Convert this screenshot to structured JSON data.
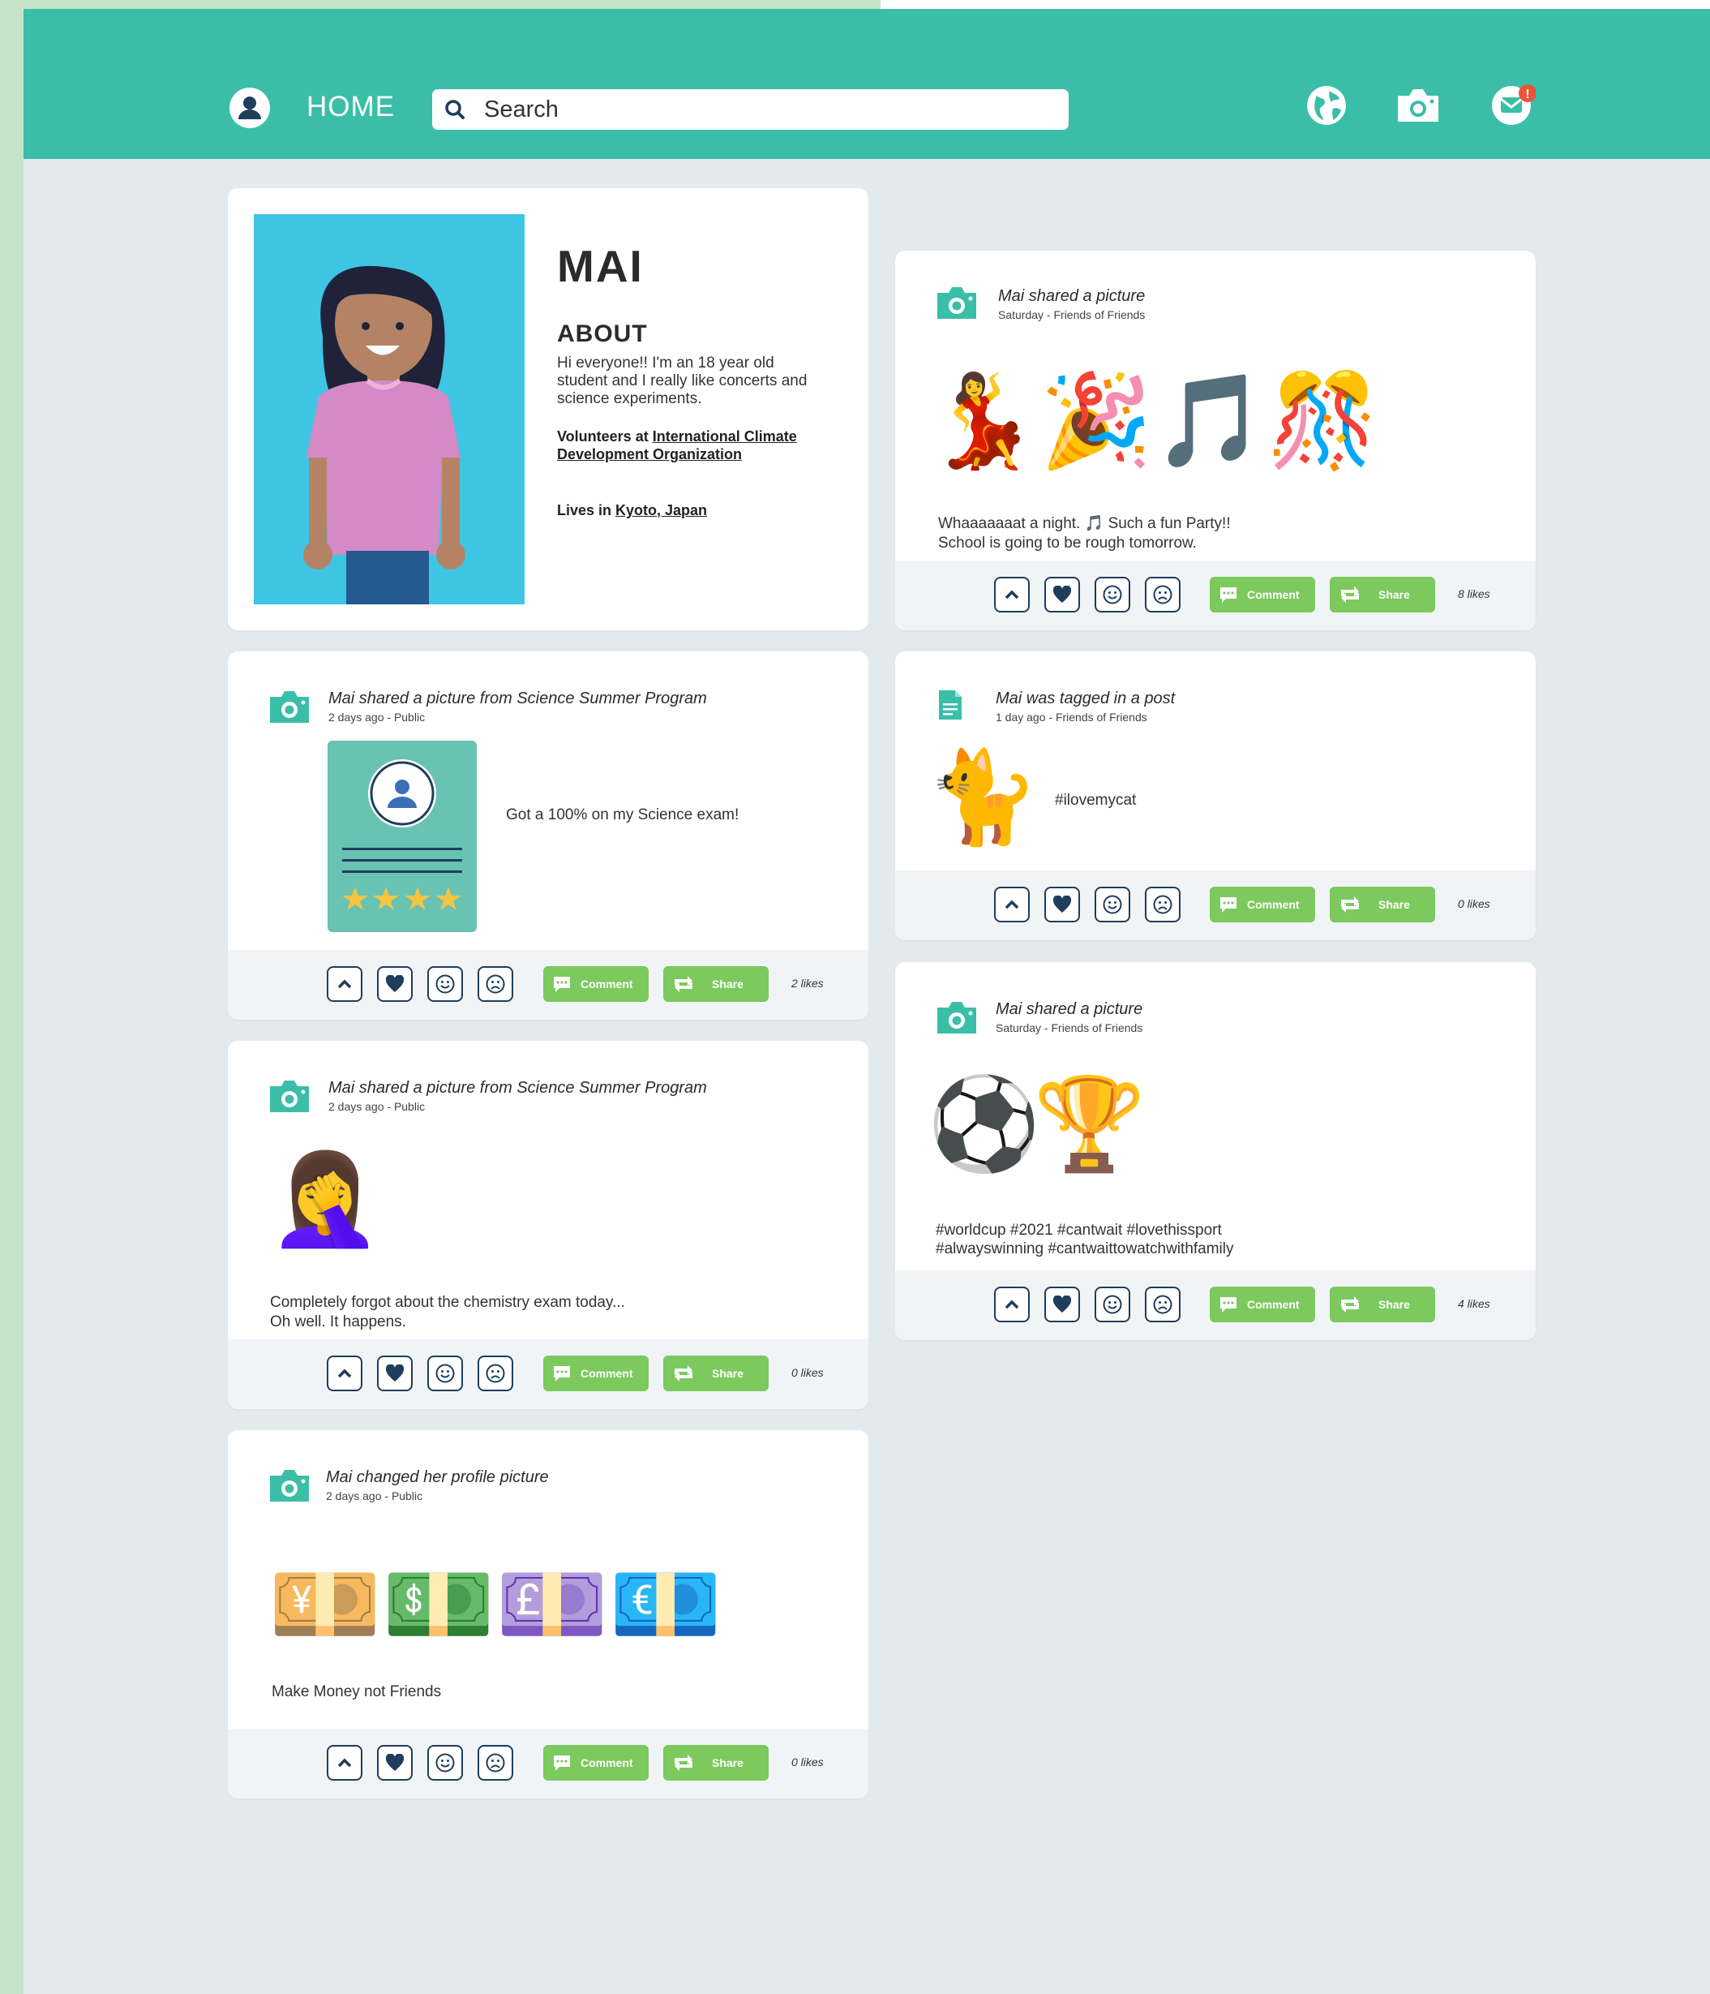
{
  "nav": {
    "home": "HOME",
    "search_placeholder": "Search"
  },
  "profile": {
    "name": "MAI",
    "about_heading": "ABOUT",
    "about_text": "Hi everyone!! I'm an 18 year old student and I really like concerts and science experiments.",
    "volunteers_prefix": "Volunteers at ",
    "volunteers_org": "International Climate Development Organization",
    "lives_prefix": "Lives in ",
    "lives_place": "Kyoto, Japan"
  },
  "actions": {
    "comment": "Comment",
    "share": "Share"
  },
  "posts": [
    {
      "title": "Mai shared a picture",
      "sub": "Saturday - Friends of Friends",
      "emojis": [
        "💃",
        "🎉",
        "🎵",
        "🎊"
      ],
      "text_line1": "Whaaaaaaat a night. 🎵 Such a fun Party!!",
      "text_line2": "School is going to be rough tomorrow.",
      "likes": "8 likes"
    },
    {
      "title": "Mai shared a picture from Science Summer Program",
      "sub": "2 days ago - Public",
      "text": "Got a 100% on my Science exam!",
      "likes": "2 likes"
    },
    {
      "title": "Mai was tagged in a post",
      "sub": "1 day ago - Friends of Friends",
      "emojis": [
        "🐈"
      ],
      "text": "#ilovemycat",
      "likes": "0 likes"
    },
    {
      "title": "Mai shared a picture from Science Summer Program",
      "sub": "2 days ago - Public",
      "emojis": [
        "🤦‍♀️"
      ],
      "text_line1": "Completely forgot about the chemistry exam today...",
      "text_line2": "Oh well. It happens.",
      "likes": "0 likes"
    },
    {
      "title": "Mai shared a picture",
      "sub": "Saturday - Friends of Friends",
      "emojis": [
        "⚽",
        "🏆"
      ],
      "text_line1": "#worldcup #2021 #cantwait #lovethissport",
      "text_line2": "#alwayswinning #cantwaittowatchwithfamily",
      "likes": "4 likes"
    },
    {
      "title": "Mai changed her profile picture",
      "sub": "2 days ago - Public",
      "emojis": [
        "💴",
        "💵",
        "💷",
        "💶"
      ],
      "text": "Make Money not Friends",
      "likes": "0 likes"
    }
  ],
  "colors": {
    "header": "#3bbea7",
    "accent_green": "#7cc95e",
    "icon_navy": "#1f3d5c",
    "badge": "#e8553a"
  },
  "icons": [
    "user-icon",
    "search-icon",
    "globe-icon",
    "camera-icon",
    "mail-icon",
    "notification-badge",
    "chevron-up-icon",
    "heart-icon",
    "smile-icon",
    "frown-icon",
    "comment-icon",
    "share-icon",
    "document-icon"
  ]
}
